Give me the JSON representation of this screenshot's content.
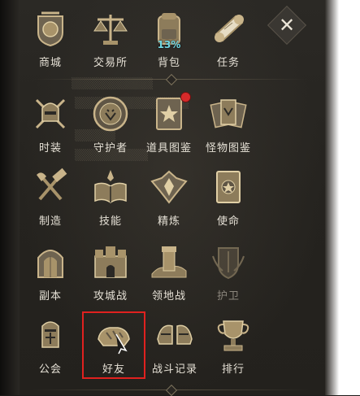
{
  "menu": {
    "items": [
      {
        "label": "商城",
        "icon": "shop-shield-icon"
      },
      {
        "label": "交易所",
        "icon": "scales-icon"
      },
      {
        "label": "背包",
        "icon": "backpack-icon",
        "capacity": "13%"
      },
      {
        "label": "任务",
        "icon": "scroll-icon"
      },
      {
        "label": "时装",
        "icon": "costume-helmet-icon"
      },
      {
        "label": "守护者",
        "icon": "lion-emblem-icon"
      },
      {
        "label": "道具图鉴",
        "icon": "item-codex-icon"
      },
      {
        "label": "怪物图鉴",
        "icon": "monster-cards-icon"
      },
      {
        "label": "制造",
        "icon": "hammer-axe-icon"
      },
      {
        "label": "技能",
        "icon": "skill-book-icon"
      },
      {
        "label": "精炼",
        "icon": "refine-crest-icon"
      },
      {
        "label": "使命",
        "icon": "mission-book-icon"
      },
      {
        "label": "副本",
        "icon": "dungeon-gate-icon"
      },
      {
        "label": "攻城战",
        "icon": "siege-castle-icon"
      },
      {
        "label": "领地战",
        "icon": "territory-tower-icon"
      },
      {
        "label": "护卫",
        "icon": "guard-shield-icon"
      },
      {
        "label": "公会",
        "icon": "guild-knight-icon"
      },
      {
        "label": "好友",
        "icon": "gauntlet-handshake-icon"
      },
      {
        "label": "战斗记录",
        "icon": "battle-record-helmets-icon"
      },
      {
        "label": "排行",
        "icon": "trophy-icon"
      }
    ],
    "close_label": "✕"
  },
  "colors": {
    "label": "#e6e1d6",
    "disabled_label": "#8c877d",
    "bronze": "#c9b48a",
    "accent_cyan": "#6fd7e3",
    "highlight_red": "#e0211f",
    "badge_red": "#d62a2a"
  }
}
